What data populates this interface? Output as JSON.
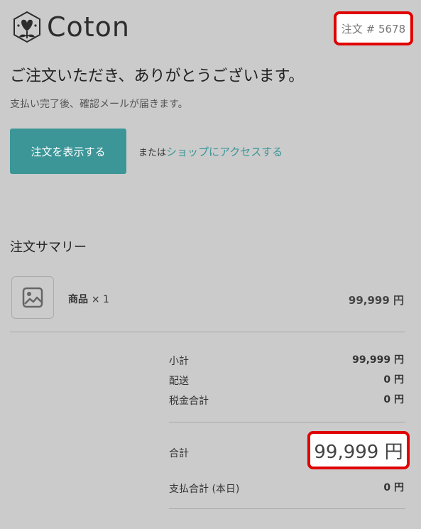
{
  "brand": {
    "name": "Coton"
  },
  "order": {
    "label": "注文 # 5678"
  },
  "confirmation": {
    "heading": "ご注文いただき、ありがとうございます。",
    "subtext": "支払い完了後、確認メールが届きます。",
    "view_order_button": "注文を表示する",
    "or_text": "または",
    "shop_link": "ショップにアクセスする"
  },
  "summary": {
    "title": "注文サマリー",
    "item": {
      "name": "商品",
      "qty": "× 1",
      "price": "99,999 円"
    },
    "subtotal_label": "小計",
    "subtotal_value": "99,999 円",
    "shipping_label": "配送",
    "shipping_value": "0 円",
    "tax_label": "税金合計",
    "tax_value": "0 円",
    "total_label": "合計",
    "total_value": "99,999 円",
    "paid_label": "支払合計 (本日)",
    "paid_value": "0 円"
  },
  "colors": {
    "background": "#cbcbcb",
    "accent": "#3c9698",
    "highlight": "#e00000"
  }
}
